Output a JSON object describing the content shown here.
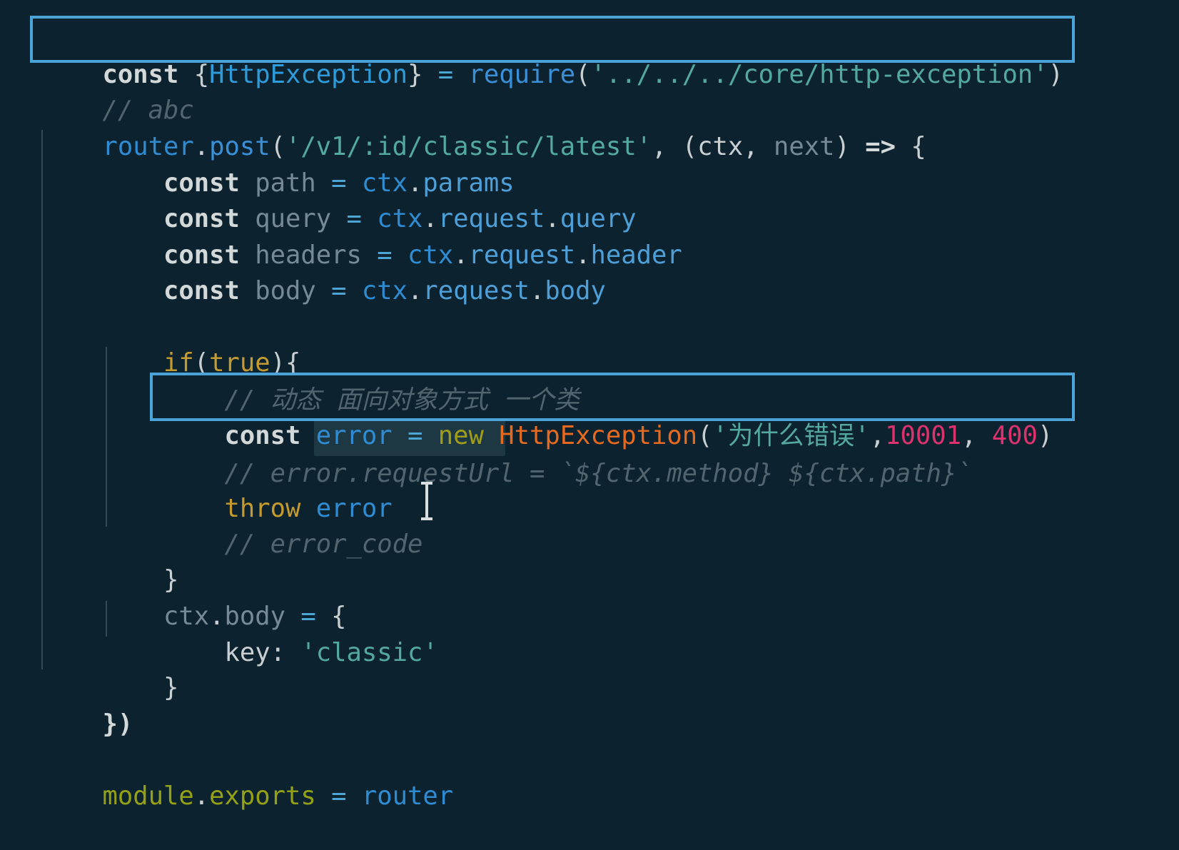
{
  "editor": {
    "line_1": {
      "t1": "const",
      "t2": " {",
      "t3": "HttpException",
      "t4": "}",
      "t5": " = ",
      "t6": "require",
      "t7": "(",
      "t8": "'../../../core/http-exception'",
      "t9": ")"
    },
    "line_2": {
      "t1": "// abc"
    },
    "line_3": {
      "t1": "router",
      "t2": ".",
      "t3": "post",
      "t4": "(",
      "t5": "'/v1/:id/classic/latest'",
      "t6": ", (",
      "t7": "ctx",
      "t8": ", ",
      "t9": "next",
      "t10": ") ",
      "t11": "=>",
      "t12": " {"
    },
    "line_4": {
      "t1": "    const",
      "t2": " path",
      "t3": " = ",
      "t4": "ctx",
      "t5": ".",
      "t6": "params"
    },
    "line_5": {
      "t1": "    const",
      "t2": " query",
      "t3": " = ",
      "t4": "ctx",
      "t5": ".",
      "t6": "request",
      "t7": ".",
      "t8": "query"
    },
    "line_6": {
      "t1": "    const",
      "t2": " headers",
      "t3": " = ",
      "t4": "ctx",
      "t5": ".",
      "t6": "request",
      "t7": ".",
      "t8": "header"
    },
    "line_7": {
      "t1": "    const",
      "t2": " body",
      "t3": " = ",
      "t4": "ctx",
      "t5": ".",
      "t6": "request",
      "t7": ".",
      "t8": "body"
    },
    "line_8": {
      "t1": "    if",
      "t2": "(",
      "t3": "true",
      "t4": "){"
    },
    "line_9": {
      "t1": "        // 动态 面向对象方式 一个类"
    },
    "line_10": {
      "t1": "        const",
      "t2": " error",
      "t3": " = ",
      "t4": "new",
      "t5": " HttpException",
      "t6": "(",
      "t7": "'为什么错误'",
      "t8": ",",
      "t9": "10001",
      "t10": ", ",
      "t11": "400",
      "t12": ")"
    },
    "line_11": {
      "t1": "        // error.requestUrl = `${ctx.method} ${ctx.path}`"
    },
    "line_12": {
      "t1": "        throw",
      "t2": " error"
    },
    "line_13": {
      "t1": "        // error_code"
    },
    "line_14": {
      "t1": "    }"
    },
    "line_15": {
      "t1": "    ctx",
      "t2": ".",
      "t3": "body",
      "t4": " = ",
      "t5": "{"
    },
    "line_16": {
      "t1": "        key",
      "t2": ": ",
      "t3": "'classic'"
    },
    "line_17": {
      "t1": "    }"
    },
    "line_18": {
      "t1": "})"
    },
    "line_19": {
      "t1": "module",
      "t2": ".",
      "t3": "exports",
      "t4": " = ",
      "t5": "router"
    }
  },
  "colors": {
    "background": "#0c232f",
    "highlight_border": "#4ba3d8",
    "keyword": "#d3d8d9",
    "string": "#53a99f",
    "comment": "#52646d",
    "error_class": "#e56a1f",
    "number": "#dc326d"
  },
  "icons": {
    "text_cursor": "text-cursor-icon"
  }
}
